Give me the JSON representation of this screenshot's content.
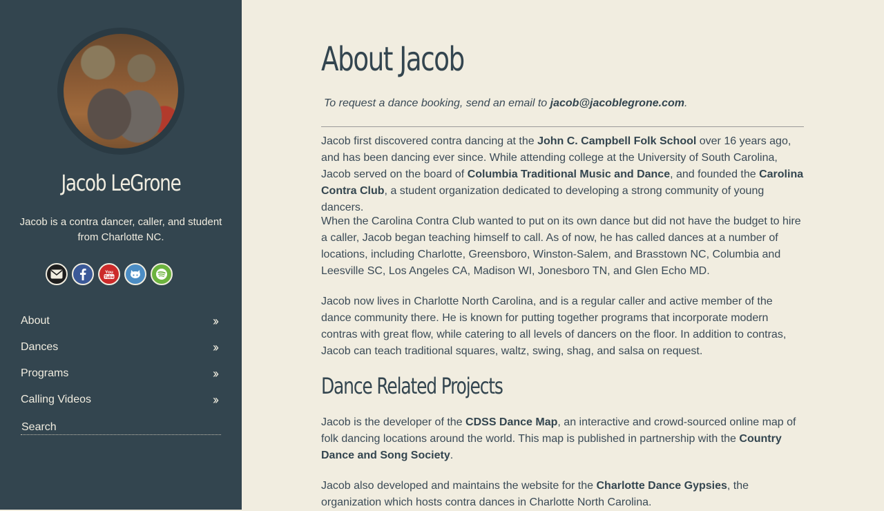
{
  "sidebar": {
    "name": "Jacob LeGrone",
    "tagline": "Jacob is a contra dancer, caller, and student from Charlotte NC.",
    "socials": [
      {
        "icon": "envelope-icon",
        "color": "#f1ede0"
      },
      {
        "icon": "facebook-icon",
        "color": "#3b5998"
      },
      {
        "icon": "youtube-icon",
        "color": "#cc2a2a"
      },
      {
        "icon": "github-icon",
        "color": "#4c8dc4"
      },
      {
        "icon": "spotify-icon",
        "color": "#6cb33e"
      }
    ],
    "nav": [
      {
        "label": "About"
      },
      {
        "label": "Dances"
      },
      {
        "label": "Programs"
      },
      {
        "label": "Calling Videos"
      }
    ],
    "search_placeholder": "Search"
  },
  "main": {
    "title": "About Jacob",
    "booking": {
      "prefix": "To request a dance booking, send an email to ",
      "email": "jacob@jacoblegrone.com",
      "suffix": "."
    },
    "p1": {
      "a": "Jacob first discovered contra dancing at the ",
      "link1": "John C. Campbell Folk School",
      "b": " over 16 years ago, and has been dancing ever since.  While attending college at the University of South Carolina, Jacob served on the board of ",
      "link2": "Columbia Traditional Music and Dance",
      "c": ", and founded the ",
      "link3": "Carolina Contra Club",
      "d": ", a student organization dedicated to developing a strong community of young dancers."
    },
    "p2": "When the Carolina Contra Club wanted to put on its own dance but did not have the budget to hire a caller, Jacob began teaching himself to call.  As of now, he has called dances at a number of locations, including Charlotte, Greensboro, Winston-Salem, and Brasstown NC, Columbia and Leesville SC, Los Angeles CA, Madison WI, Jonesboro TN, and Glen Echo MD.",
    "p3": "Jacob now lives in Charlotte North Carolina, and is a regular caller and active member of the dance community there.  He is known for putting together programs that incorporate modern contras with great flow, while catering to all levels of dancers on the floor.  In addition to contras, Jacob can teach traditional squares, waltz, swing, shag, and salsa on request.",
    "subtitle": "Dance Related Projects",
    "p4": {
      "a": "Jacob is the developer of the ",
      "link1": "CDSS Dance Map",
      "b": ", an interactive and crowd-sourced online map of folk dancing locations around the world.  This map is published in partnership with the ",
      "link2": "Country Dance and Song Society",
      "c": "."
    },
    "p5": {
      "a": "Jacob also developed and maintains the website for the ",
      "link1": "Charlotte Dance Gypsies",
      "b": ", the organization which hosts contra dances in Charlotte North Carolina."
    }
  }
}
